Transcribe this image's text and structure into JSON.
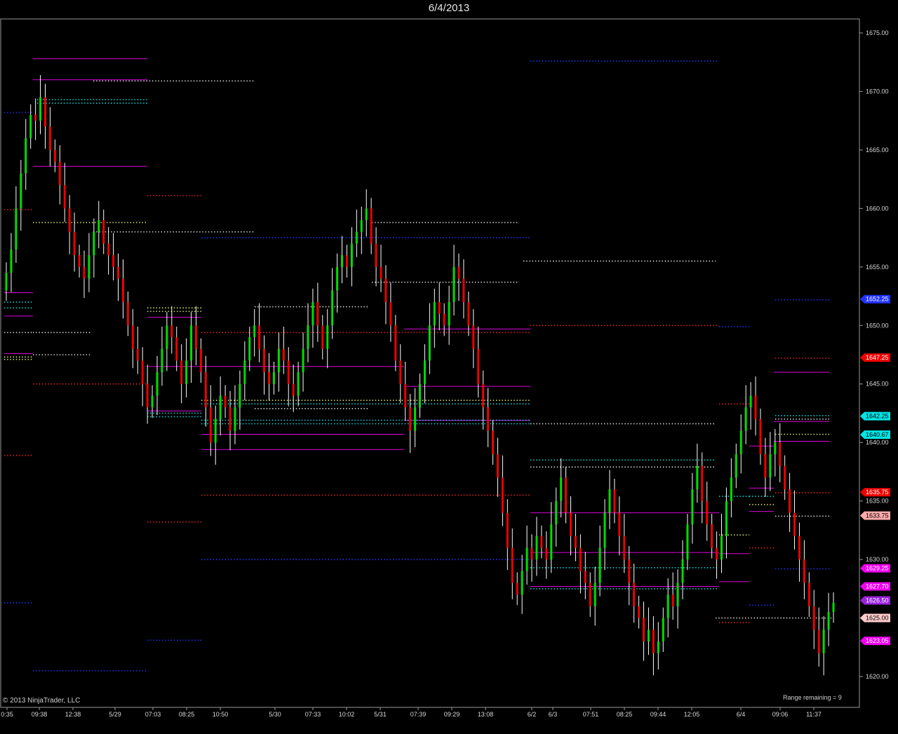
{
  "title": "6/4/2013",
  "copyright": "© 2013 NinjaTrader, LLC",
  "range_remaining": "Range remaining = 9",
  "colors": {
    "up": "#00dd00",
    "down": "#ee0000",
    "neutral": "#ffffff",
    "magenta": "#dd00dd",
    "blue": "#2233ff",
    "red": "#ee2222",
    "cyan": "#00dddd",
    "white": "#dddddd",
    "yellow": "#ddee66"
  },
  "chart_data": {
    "type": "candlestick",
    "ylim": [
      1617.5,
      1676
    ],
    "y_ticks": [
      "1675.00",
      "1670.00",
      "1665.00",
      "1660.00",
      "1655.00",
      "1650.00",
      "1645.00",
      "1640.00",
      "1635.00",
      "1630.00",
      "1625.00",
      "1620.00"
    ],
    "x_labels": [
      "0:35",
      "09:38",
      "12:38",
      "5/29",
      "07:03",
      "08:25",
      "10:50",
      "5/30",
      "07:33",
      "10:02",
      "5/31",
      "07:39",
      "09:29",
      "13:08",
      "6/2",
      "6/3",
      "07:51",
      "08:25",
      "09:44",
      "12:05",
      "6/4",
      "09:06",
      "11:37"
    ],
    "price_tags": [
      {
        "label": "1652.25",
        "value": 1652.25,
        "color": "#2233ff",
        "text": "#ffffff"
      },
      {
        "label": "1647.25",
        "value": 1647.25,
        "color": "#ee0000",
        "text": "#ffffff"
      },
      {
        "label": "1642.25",
        "value": 1642.25,
        "color": "#00e5e5",
        "text": "#000000"
      },
      {
        "label": "1640.67",
        "value": 1640.67,
        "color": "#00e5e5",
        "text": "#000000"
      },
      {
        "label": "1635.75",
        "value": 1635.75,
        "color": "#ee0000",
        "text": "#ffffff"
      },
      {
        "label": "1633.75",
        "value": 1633.75,
        "color": "#ffaaaa",
        "text": "#000000"
      },
      {
        "label": "1629.25",
        "value": 1629.25,
        "color": "#ee00ee",
        "text": "#ffffff"
      },
      {
        "label": "1627.70",
        "value": 1627.7,
        "color": "#ee00ee",
        "text": "#ffffff"
      },
      {
        "label": "1626.50",
        "value": 1626.5,
        "color": "#9922dd",
        "text": "#ffffff"
      },
      {
        "label": "1625.00",
        "value": 1625.0,
        "color": "#ffcccc",
        "text": "#000000"
      },
      {
        "label": "1623.05",
        "value": 1623.05,
        "color": "#ee00ee",
        "text": "#ffffff"
      }
    ],
    "closes": [
      1654.5,
      1656.5,
      1660,
      1663,
      1666,
      1668,
      1667.5,
      1669.5,
      1667,
      1665,
      1664,
      1662,
      1660,
      1658,
      1656,
      1655,
      1654,
      1656,
      1658,
      1659,
      1657,
      1656,
      1655,
      1654,
      1652,
      1650,
      1648,
      1647,
      1645,
      1643,
      1644,
      1646,
      1648,
      1650,
      1649,
      1647,
      1645,
      1647,
      1650,
      1648,
      1646,
      1643,
      1640,
      1642,
      1644,
      1643,
      1641,
      1643,
      1645,
      1647,
      1649,
      1650,
      1648,
      1646,
      1645,
      1646,
      1648,
      1647,
      1645,
      1644,
      1646,
      1648,
      1650,
      1652,
      1650,
      1648,
      1650,
      1653,
      1655,
      1656,
      1655,
      1657,
      1658,
      1659,
      1660,
      1657,
      1655,
      1654,
      1652,
      1650,
      1647,
      1645,
      1643,
      1641,
      1643,
      1645,
      1647,
      1650,
      1652,
      1651,
      1650,
      1652,
      1655,
      1654,
      1652,
      1650,
      1648,
      1645,
      1643,
      1641,
      1639,
      1637,
      1634,
      1631,
      1628,
      1627,
      1629,
      1631,
      1630,
      1632,
      1631,
      1630,
      1633,
      1635,
      1637,
      1634,
      1632,
      1631,
      1629,
      1628,
      1626,
      1628,
      1631,
      1634,
      1636,
      1634,
      1632,
      1630,
      1628,
      1626,
      1625,
      1623,
      1624,
      1622,
      1623,
      1625,
      1627,
      1626,
      1628,
      1630,
      1633,
      1636,
      1638,
      1635,
      1633,
      1631,
      1630,
      1632,
      1635,
      1637,
      1639,
      1641,
      1643,
      1644,
      1642,
      1639,
      1637,
      1639,
      1640,
      1638,
      1636,
      1634,
      1632,
      1630,
      1628,
      1626,
      1624,
      1622,
      1624,
      1625.5,
      1626.3
    ]
  }
}
